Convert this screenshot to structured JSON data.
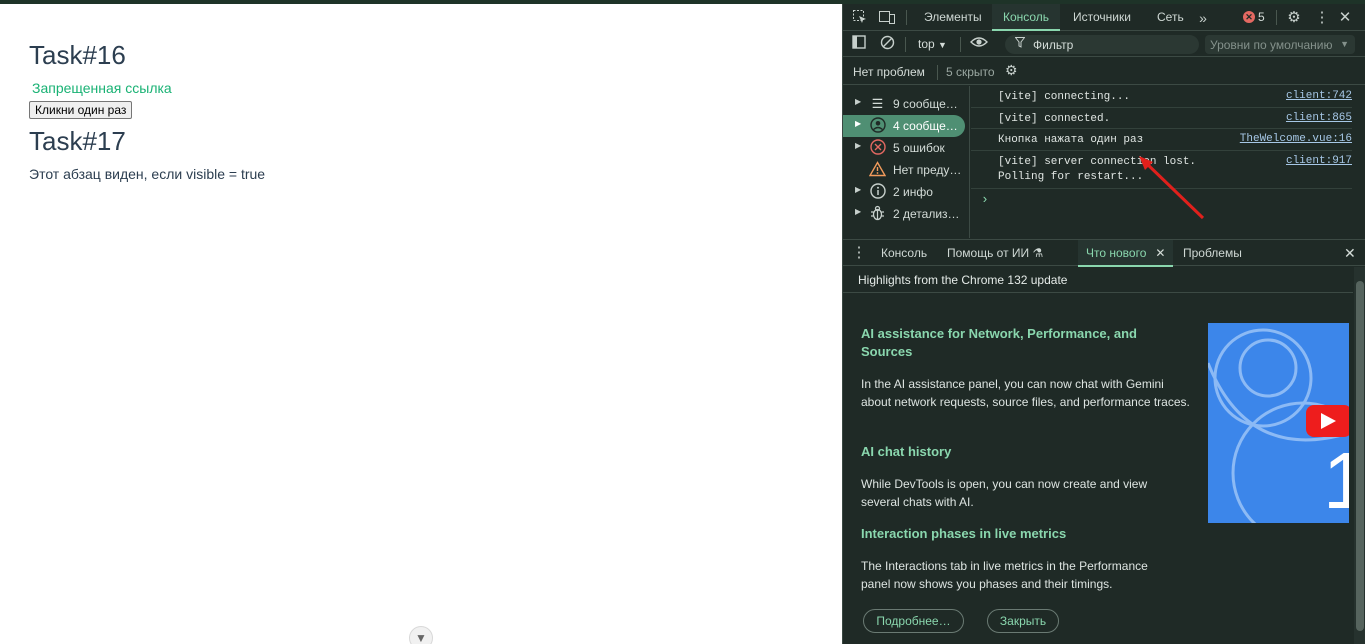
{
  "page": {
    "task16_title": "Task#16",
    "forbidden_link": "Запрещенная ссылка",
    "click_once_button": "Кликни один раз",
    "task17_title": "Task#17",
    "visible_paragraph": "Этот абзац виден, если visible = true"
  },
  "devtools": {
    "tabs": [
      "Элементы",
      "Консоль",
      "Источники",
      "Сеть"
    ],
    "active_tab": "Консоль",
    "error_count": "5",
    "toolbar": {
      "context": "top",
      "filter_placeholder": "Фильтр",
      "levels": "Уровни по умолчанию"
    },
    "issues": {
      "no_problems": "Нет проблем",
      "hidden": "5 скрыто"
    },
    "sidebar": [
      {
        "label": "9 сообще…",
        "icon": "list-icon"
      },
      {
        "label": "4 сообще…",
        "icon": "user-icon",
        "active": true
      },
      {
        "label": "5 ошибок",
        "icon": "error-icon"
      },
      {
        "label": "Нет преду…",
        "icon": "warning-icon"
      },
      {
        "label": "2 инфо",
        "icon": "info-icon"
      },
      {
        "label": "2 детализ…",
        "icon": "bug-icon"
      }
    ],
    "logs": [
      {
        "message": "[vite] connecting...",
        "source": "client:742"
      },
      {
        "message": "[vite] connected.",
        "source": "client:865"
      },
      {
        "message": "Кнопка нажата один раз",
        "source": "TheWelcome.vue:16"
      },
      {
        "message": "[vite] server connection lost. Polling for restart...",
        "source": "client:917"
      }
    ],
    "drawer_tabs": [
      "Консоль",
      "Помощь от ИИ",
      "Что нового",
      "Проблемы"
    ],
    "active_drawer_tab": "Что нового",
    "whats_new": {
      "header": "Highlights from the Chrome 132 update",
      "sections": [
        {
          "title": "AI assistance for Network, Performance, and Sources",
          "body": "In the AI assistance panel, you can now chat with Gemini about network requests, source files, and performance traces."
        },
        {
          "title": "AI chat history",
          "body": "While DevTools is open, you can now create and view several chats with AI."
        },
        {
          "title": "Interaction phases in live metrics",
          "body": "The Interactions tab in live metrics in the Performance panel now shows you phases and their timings."
        }
      ],
      "more_button": "Подробнее…",
      "close_button": "Закрыть"
    }
  },
  "colors": {
    "accent_green": "#8ad7ae",
    "link_green": "#19b274",
    "annotation_arrow": "#e0201c"
  }
}
